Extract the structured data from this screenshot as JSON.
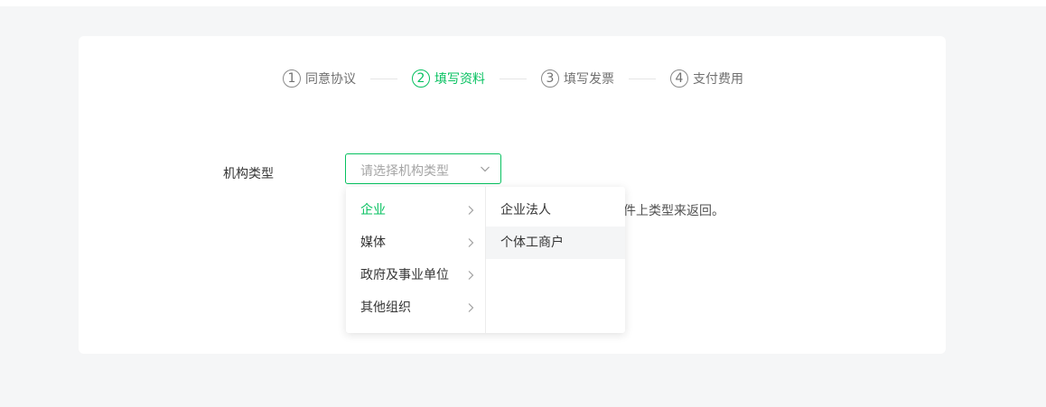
{
  "stepper": {
    "steps": [
      {
        "num": "1",
        "label": "同意协议",
        "active": false
      },
      {
        "num": "2",
        "label": "填写资料",
        "active": true
      },
      {
        "num": "3",
        "label": "填写发票",
        "active": false
      },
      {
        "num": "4",
        "label": "支付费用",
        "active": false
      }
    ]
  },
  "form": {
    "org_type_label": "机构类型",
    "org_type_placeholder": "请选择机构类型",
    "hint_partial": "件上类型来返回。"
  },
  "cascader": {
    "level1": [
      "企业",
      "媒体",
      "政府及事业单位",
      "其他组织"
    ],
    "level1_selected": "企业",
    "level2": [
      "企业法人",
      "个体工商户"
    ],
    "level2_hovered": "个体工商户"
  },
  "colors": {
    "accent": "#07c160",
    "page_bg": "#f5f6f7",
    "card_bg": "#ffffff",
    "text": "#353535",
    "placeholder": "#a5a5a5"
  },
  "icons": {
    "select_chevron": "chevron-down-icon",
    "option_arrow": "chevron-right-icon"
  }
}
